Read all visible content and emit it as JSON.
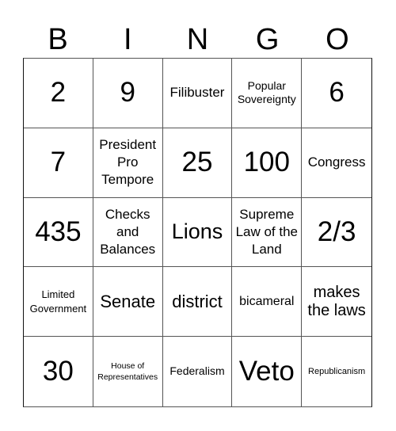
{
  "header": {
    "letters": [
      "B",
      "I",
      "N",
      "G",
      "O"
    ]
  },
  "card": {
    "rows": [
      [
        "2",
        "9",
        "Filibuster",
        "Popular Sovereignty",
        "6"
      ],
      [
        "7",
        "President Pro Tempore",
        "25",
        "100",
        "Congress"
      ],
      [
        "435",
        "Checks and Balances",
        "Lions",
        "Supreme Law of the Land",
        "2/3"
      ],
      [
        "Limited Government",
        "Senate",
        "district",
        "bicameral",
        "makes the laws"
      ],
      [
        "30",
        "House of Representatives",
        "Federalism",
        "Veto",
        "Republicanism"
      ]
    ]
  }
}
